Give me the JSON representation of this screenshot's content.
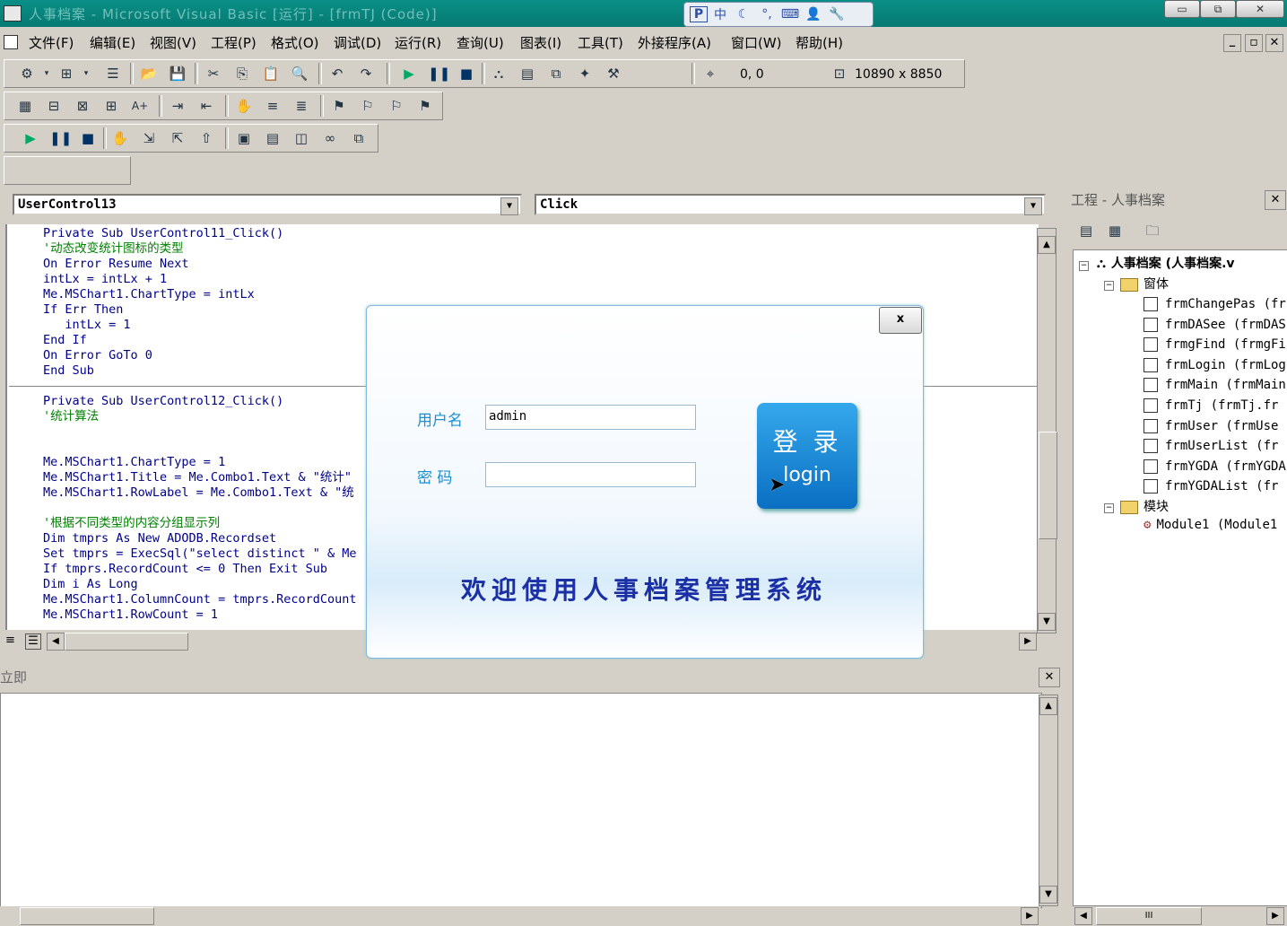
{
  "window": {
    "title": "人事档案 - Microsoft Visual Basic [运行] - [frmTJ (Code)]",
    "min": "▭",
    "max": "⧉",
    "close": "✕"
  },
  "ime": {
    "items": [
      "P",
      "中",
      "☾",
      "°,",
      "⌨",
      "👤",
      "🔧"
    ]
  },
  "menu": {
    "items": [
      "文件(F)",
      "编辑(E)",
      "视图(V)",
      "工程(P)",
      "格式(O)",
      "调试(D)",
      "运行(R)",
      "查询(U)",
      "图表(I)",
      "工具(T)",
      "外接程序(A)",
      "窗口(W)",
      "帮助(H)"
    ],
    "mdi_min": "_",
    "mdi_restore": "▫",
    "mdi_close": "✕"
  },
  "toolbar": {
    "position": "0, 0",
    "size": "10890 x 8850"
  },
  "code": {
    "object_combo": "UserControl13",
    "proc_combo": "Click",
    "lines": [
      {
        "text": "Private Sub UserControl11_Click()",
        "kind": "code"
      },
      {
        "text": "'动态改变统计图标的类型",
        "kind": "comment"
      },
      {
        "text": "On Error Resume Next",
        "kind": "code"
      },
      {
        "text": "intLx = intLx + 1",
        "kind": "code"
      },
      {
        "text": "Me.MSChart1.ChartType = intLx",
        "kind": "code"
      },
      {
        "text": "If Err Then",
        "kind": "code"
      },
      {
        "text": "   intLx = 1",
        "kind": "code"
      },
      {
        "text": "End If",
        "kind": "code"
      },
      {
        "text": "On Error GoTo 0",
        "kind": "code"
      },
      {
        "text": "End Sub",
        "kind": "code"
      },
      {
        "text": "",
        "kind": "sep"
      },
      {
        "text": "Private Sub UserControl12_Click()",
        "kind": "code"
      },
      {
        "text": "'统计算法",
        "kind": "comment"
      },
      {
        "text": "",
        "kind": "code"
      },
      {
        "text": "",
        "kind": "code"
      },
      {
        "text": "Me.MSChart1.ChartType = 1",
        "kind": "code"
      },
      {
        "text": "Me.MSChart1.Title = Me.Combo1.Text & \"统计\"",
        "kind": "code"
      },
      {
        "text": "Me.MSChart1.RowLabel = Me.Combo1.Text & \"统",
        "kind": "code"
      },
      {
        "text": "",
        "kind": "code"
      },
      {
        "text": "'根据不同类型的内容分组显示列",
        "kind": "comment"
      },
      {
        "text": "Dim tmprs As New ADODB.Recordset",
        "kind": "code"
      },
      {
        "text": "Set tmprs = ExecSql(\"select distinct \" & Me",
        "kind": "code"
      },
      {
        "text": "If tmprs.RecordCount <= 0 Then Exit Sub",
        "kind": "code"
      },
      {
        "text": "Dim i As Long",
        "kind": "code"
      },
      {
        "text": "Me.MSChart1.ColumnCount = tmprs.RecordCount",
        "kind": "code"
      },
      {
        "text": "Me.MSChart1.RowCount = 1",
        "kind": "code"
      }
    ]
  },
  "immediate": {
    "title": "立即",
    "close": "✕"
  },
  "project": {
    "title": "工程 - 人事档案",
    "close": "✕",
    "root": "人事档案 (人事档案.v",
    "forms_folder": "窗体",
    "forms": [
      "frmChangePas (fr",
      "frmDASee (frmDAS",
      "frmgFind (frmgFi",
      "frmLogin (frmLog",
      "frmMain (frmMain",
      "frmTj (frmTj.fr",
      "frmUser (frmUse",
      "frmUserList (fr",
      "frmYGDA (frmYGDA",
      "frmYGDAList (fr"
    ],
    "modules_folder": "模块",
    "modules": [
      "Module1 (Module1"
    ]
  },
  "dialog": {
    "close_label": "x",
    "username_label": "用户名",
    "username_value": "admin",
    "password_label": "密  码",
    "password_value": "",
    "login_cn": "登 录",
    "login_en": "login",
    "welcome": "欢迎使用人事档案管理系统"
  },
  "colors": {
    "title_bar": "#0a8f86",
    "keyword": "#00008b",
    "comment": "#008000",
    "dialog_label": "#1a8fd1",
    "welcome_text": "#1b2fa6",
    "login_button": "#1a8ad8"
  }
}
